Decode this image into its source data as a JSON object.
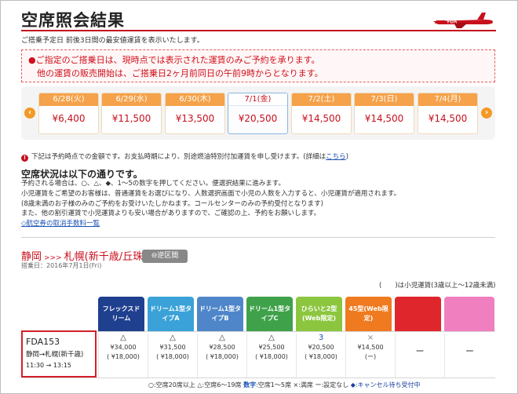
{
  "header": {
    "title": "空席照会結果",
    "subtitle": "ご搭乗予定日 前後3日間の最安値運賃を表示いたします。",
    "logo_text": "FDA"
  },
  "notice": {
    "line1": "ご指定のご搭乗日は、現時点では表示された運賃のみご予約を承ります。",
    "line2": "他の運賃の販売開始は、ご搭乗日2ヶ月前同日の午前9時からとなります。"
  },
  "carousel": {
    "prev_icon": "chevron-left-icon",
    "next_icon": "chevron-right-icon",
    "days": [
      {
        "label": "6/28(火)",
        "price": "¥6,400"
      },
      {
        "label": "6/29(水)",
        "price": "¥11,500"
      },
      {
        "label": "6/30(木)",
        "price": "¥13,500"
      },
      {
        "label": "7/1(金)",
        "price": "¥20,500"
      },
      {
        "label": "7/2(土)",
        "price": "¥14,500"
      },
      {
        "label": "7/3(日)",
        "price": "¥14,500"
      },
      {
        "label": "7/4(月)",
        "price": "¥14,500"
      }
    ],
    "selected_index": 3
  },
  "info": {
    "text": "下記は予約時点での金額です。お支払時期により、別途燃油特別付加運賃を申し受けます。(詳細は",
    "link": "こちら",
    "close": ")"
  },
  "vacancy": {
    "heading": "空席状況は以下の通りです。",
    "lines": [
      "予約される場合は、○、△、◆、1〜5の数字を押してください。便選択結果に進みます。",
      "小児運賃をご希望のお客様は、普通運賃をお選びになり、人数選択画面で小児の人数を入力すると、小児運賃が適用されます。",
      "(8歳未満のお子様のみのご予約をお受けいたしかねます。コールセンターのみの予約受付となります)",
      "また、他の割引運賃で小児運賃よりも安い場合がありますので、ご確認の上、予約をお願いします。"
    ],
    "cancel_link": "◇航空券の取消手数料一覧"
  },
  "route": {
    "from": "静岡",
    "sep": ">>>",
    "to": "札幌(新千歳/丘珠)",
    "reverse_button": "⊖逆区間",
    "boarding_date": "搭乗日：2016年7月1日(Fri)",
    "child_note": "(　　)は小児運賃(3歳以上〜12歳未満)"
  },
  "fare_columns": [
    {
      "label": "フレックスドリーム",
      "color": "#1f3f8f"
    },
    {
      "label": "ドリーム1型タイプA",
      "color": "#3aa2d8"
    },
    {
      "label": "ドリーム1型タイプB",
      "color": "#4f86c9"
    },
    {
      "label": "ドリーム1型タイプC",
      "color": "#3fa24a"
    },
    {
      "label": "ひらいと2型(Web限定)",
      "color": "#8cc63f"
    },
    {
      "label": "45型(Web限定)",
      "color": "#ef7a1f"
    },
    {
      "label": "",
      "color": "#e0262d"
    },
    {
      "label": "",
      "color": "#f07fbf"
    }
  ],
  "flight": {
    "number": "FDA153",
    "route": "静岡→札幌(新千歳)",
    "time": "11:30 → 13:15",
    "fares": [
      {
        "mark": "△",
        "price": "¥34,000",
        "child": "( ¥18,000)"
      },
      {
        "mark": "△",
        "price": "¥31,500",
        "child": "( ¥18,000)"
      },
      {
        "mark": "△",
        "price": "¥28,500",
        "child": "( ¥18,000)"
      },
      {
        "mark": "△",
        "price": "¥25,500",
        "child": "( ¥18,000)"
      },
      {
        "mark": "3",
        "price": "¥20,500",
        "child": "( ¥18,000)"
      },
      {
        "mark": "×",
        "price": "¥14,500",
        "child": "(ー)"
      },
      {
        "mark": "",
        "price": "",
        "child": "",
        "dash": "ー"
      },
      {
        "mark": "",
        "price": "",
        "child": "",
        "dash": "ー"
      }
    ]
  },
  "legend": {
    "a": "○:空席20席以上",
    "b": "△:空席6〜19席",
    "c_prefix": "数字",
    "c": ":空席1〜5席",
    "d": "×:満席",
    "e": "ー:設定なし",
    "f": "◆:キャンセル待ち受付中"
  }
}
